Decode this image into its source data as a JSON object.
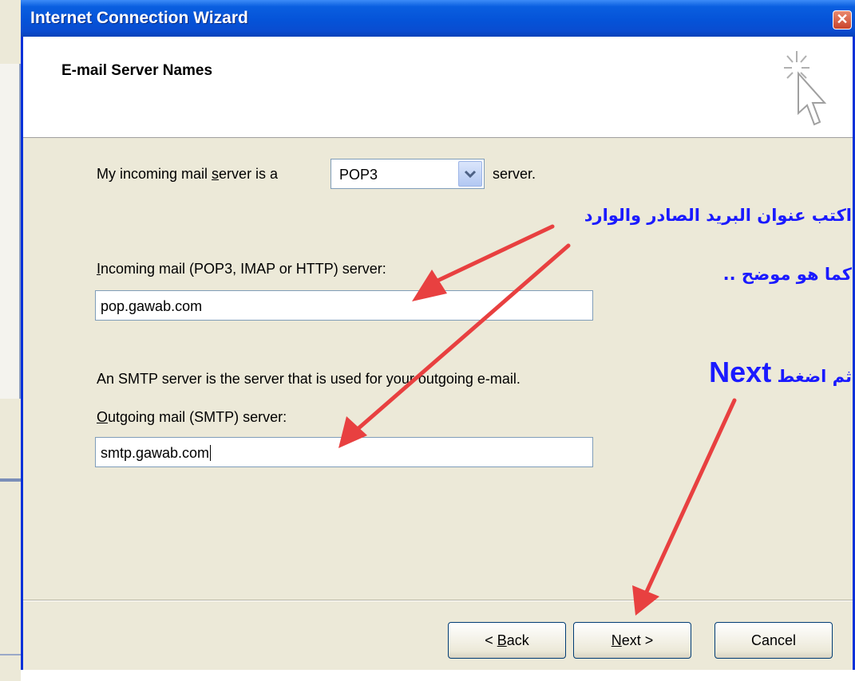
{
  "window": {
    "title": "Internet Connection Wizard",
    "close_glyph": "✕"
  },
  "header": {
    "title": "E-mail Server Names"
  },
  "form": {
    "incoming_type_prefix_pre": "My incoming mail ",
    "incoming_type_prefix_mnemonic": "s",
    "incoming_type_prefix_post": "erver is a",
    "server_type_value": "POP3",
    "incoming_type_suffix": "server.",
    "incoming_label_mnemonic": "I",
    "incoming_label_rest": "ncoming mail (POP3, IMAP or HTTP) server:",
    "incoming_value": "pop.gawab.com",
    "smtp_info": "An SMTP server is the server that is used for your outgoing e-mail.",
    "outgoing_label_mnemonic": "O",
    "outgoing_label_rest": "utgoing mail (SMTP) server:",
    "outgoing_value": "smtp.gawab.com"
  },
  "buttons": {
    "back_prefix": "< ",
    "back_mnemonic": "B",
    "back_rest": "ack",
    "next_mnemonic": "N",
    "next_rest": "ext >",
    "cancel": "Cancel"
  },
  "annotations": {
    "line1": "اكتب عنوان البريد الصادر والوارد",
    "line2": "كما هو موضح ..",
    "line3_ar": "ثم اضغط",
    "line3_en": "Next",
    "arrow_color": "#e84040",
    "text_color": "#1a1aff"
  },
  "colors": {
    "title_bar": "#0553d8",
    "dialog_bg": "#ece9d8",
    "field_border": "#7f9db9"
  }
}
